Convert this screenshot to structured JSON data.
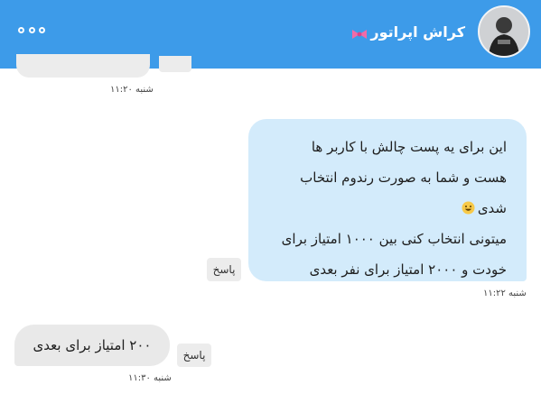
{
  "header": {
    "contact_name": "کراش اپراتور",
    "menu_icon": "more-dots-icon",
    "bow_icon": "ribbon-bow-emoji",
    "colors": {
      "bar": "#3d9be9",
      "text": "#ffffff"
    }
  },
  "messages": [
    {
      "id": "partial-top",
      "direction": "received",
      "text": "",
      "timestamp": "شنبه ۱۱:۲۰"
    },
    {
      "id": "challenge",
      "direction": "sent",
      "lines": [
        "این برای یه پست چالش با کاربر ها",
        "هست و شما به صورت رندوم انتخاب",
        "شدی",
        "میتونی انتخاب کنی بین ۱۰۰۰ امتیاز برای",
        "خودت و ۲۰۰۰ امتیاز برای نفر بعدی"
      ],
      "emoji": "grinning-face-emoji",
      "reply_label": "پاسخ",
      "timestamp": "شنبه ۱۱:۲۲"
    },
    {
      "id": "answer",
      "direction": "received",
      "text": "۲۰۰ امتیاز برای بعدی",
      "reply_label": "پاسخ",
      "timestamp": "شنبه ۱۱:۳۰"
    }
  ],
  "colors": {
    "sent_bubble": "#d3ebfb",
    "received_bubble": "#e9e9e9",
    "reply_button": "#ececec"
  }
}
